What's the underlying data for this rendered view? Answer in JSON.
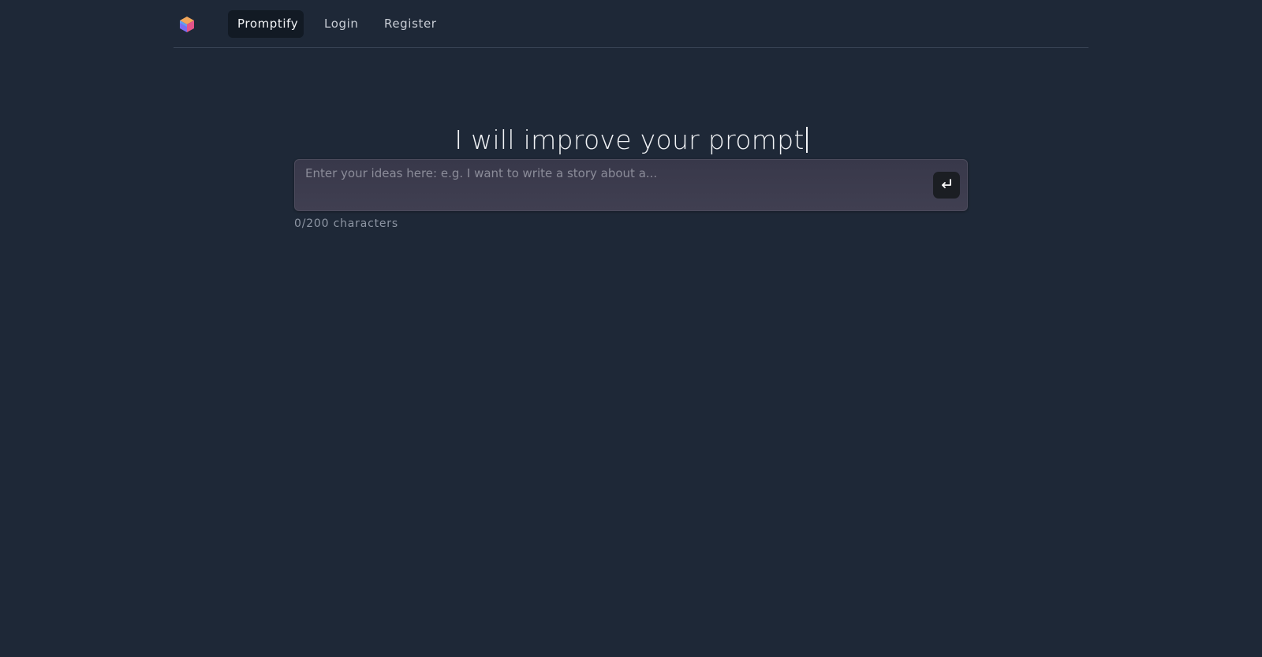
{
  "nav": {
    "logo_icon": "cube-logo-icon",
    "items": [
      {
        "label": "Promptify",
        "active": true
      },
      {
        "label": "Login",
        "active": false
      },
      {
        "label": "Register",
        "active": false
      }
    ]
  },
  "hero": {
    "headline": "I will improve your prompt"
  },
  "prompt": {
    "value": "",
    "placeholder": "Enter your ideas here: e.g. I want to write a story about a...",
    "submit_icon": "enter-return-icon",
    "counter": "0/200 characters"
  },
  "colors": {
    "background": "#1e2837",
    "active_nav_bg": "#121a24",
    "input_bg": "#3a3a4c",
    "submit_bg": "#1b1e23"
  }
}
